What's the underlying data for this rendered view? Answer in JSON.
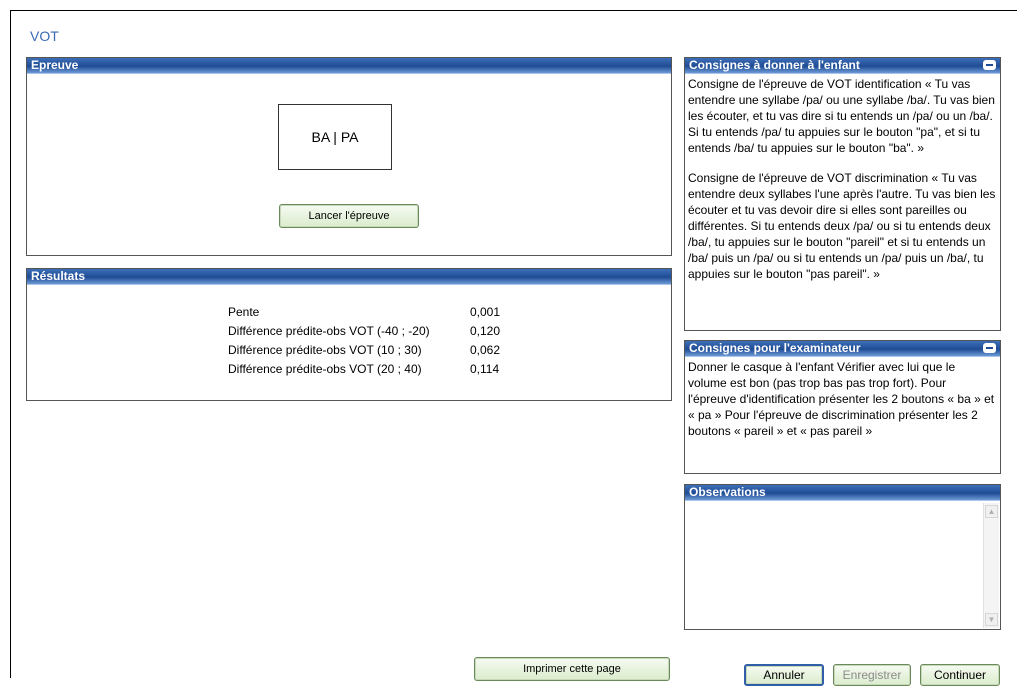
{
  "page": {
    "title": "VOT"
  },
  "epreuve": {
    "header": "Epreuve",
    "stimulus": "BA | PA",
    "launch_button": "Lancer l'épreuve"
  },
  "resultats": {
    "header": "Résultats",
    "rows": [
      {
        "label": "Pente",
        "value": "0,001"
      },
      {
        "label": "Différence prédite-obs VOT (-40 ; -20)",
        "value": "0,120"
      },
      {
        "label": "Différence prédite-obs VOT (10 ; 30)",
        "value": "0,062"
      },
      {
        "label": "Différence prédite-obs VOT (20 ; 40)",
        "value": "0,114"
      }
    ]
  },
  "consignes_enfant": {
    "header": "Consignes à donner à l'enfant",
    "paragraph1": "Consigne de l'épreuve de VOT identification « Tu vas entendre une syllabe /pa/ ou une syllabe /ba/. Tu vas bien les écouter, et tu vas dire si tu entends un /pa/ ou un /ba/. Si tu entends /pa/ tu appuies sur le bouton \"pa\", et si tu entends /ba/ tu appuies sur le bouton \"ba\". »",
    "paragraph2": "Consigne de l'épreuve de VOT discrimination « Tu vas entendre deux syllabes l'une après l'autre. Tu vas bien les écouter et tu vas devoir dire si elles sont pareilles ou différentes. Si tu entends deux /pa/ ou si tu entends deux /ba/, tu appuies sur le bouton \"pareil\" et si tu entends un /ba/ puis un /pa/ ou si tu entends un /pa/ puis un /ba/, tu appuies sur le bouton \"pas pareil\". »"
  },
  "consignes_examinateur": {
    "header": "Consignes pour l'examinateur",
    "text": "Donner le casque à l'enfant Vérifier avec lui que le volume est bon (pas trop bas pas trop fort). Pour l'épreuve d'identification présenter les 2 boutons « ba » et « pa » Pour l'épreuve de discrimination présenter les 2 boutons « pareil » et « pas pareil »"
  },
  "observations": {
    "header": "Observations",
    "value": ""
  },
  "footer": {
    "print_button": "Imprimer cette page",
    "cancel_button": "Annuler",
    "save_button": "Enregistrer",
    "continue_button": "Continuer"
  },
  "colors": {
    "header_blue": "#1f4c94",
    "title_blue": "#3a6ab4",
    "button_green": "#dbeccd"
  }
}
